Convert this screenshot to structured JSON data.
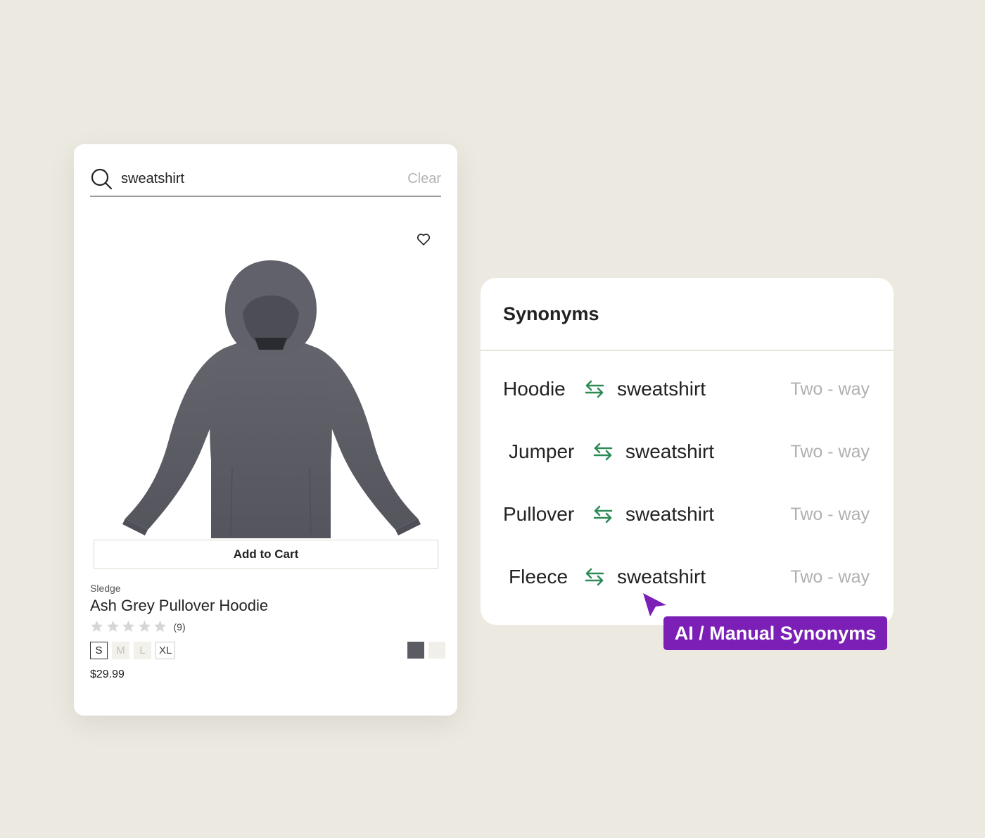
{
  "search": {
    "query": "sweatshirt",
    "clear_label": "Clear"
  },
  "product": {
    "add_to_cart_label": "Add to Cart",
    "brand": "Sledge",
    "title": "Ash Grey Pullover Hoodie",
    "rating_stars": 5,
    "review_count": "(9)",
    "sizes": [
      {
        "label": "S",
        "state": "selected"
      },
      {
        "label": "M",
        "state": "unavailable"
      },
      {
        "label": "L",
        "state": "unavailable"
      },
      {
        "label": "XL",
        "state": "available"
      }
    ],
    "swatches": [
      "#5a5b63",
      "#f1efe9"
    ],
    "price": "$29.99",
    "icons": [
      "search-icon",
      "heart-icon",
      "star-icon"
    ]
  },
  "synonyms": {
    "title": "Synonyms",
    "rows": [
      {
        "term": "Hoodie",
        "target": "sweatshirt",
        "mode": "Two - way"
      },
      {
        "term": "Jumper",
        "target": "sweatshirt",
        "mode": "Two - way"
      },
      {
        "term": "Pullover",
        "target": "sweatshirt",
        "mode": "Two - way"
      },
      {
        "term": "Fleece",
        "target": "sweatshirt",
        "mode": "Two - way"
      }
    ],
    "icon": "swap-arrows-icon"
  },
  "badge": {
    "label": "AI / Manual Synonyms"
  },
  "colors": {
    "background": "#ece9e1",
    "accent_purple": "#7b1fb6",
    "swap_green": "#2e8b57",
    "muted_text": "#b0b0b0"
  }
}
